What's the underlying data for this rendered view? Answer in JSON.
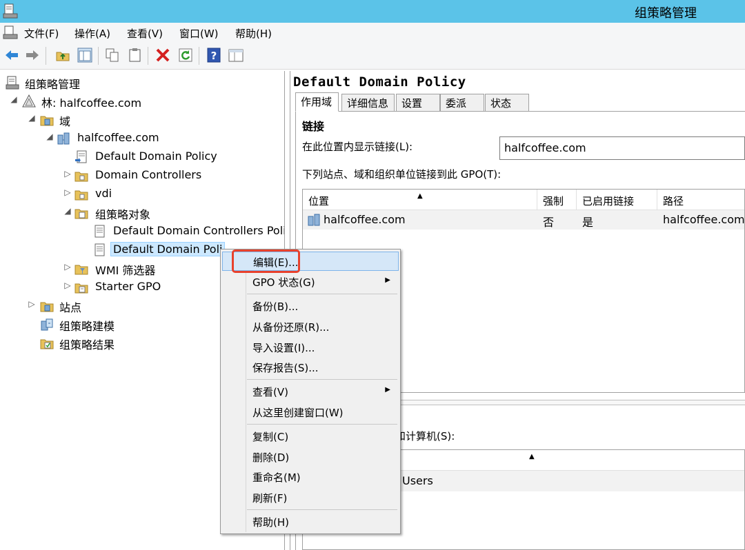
{
  "window": {
    "title": "组策略管理"
  },
  "menubar": {
    "items": [
      "文件(F)",
      "操作(A)",
      "查看(V)",
      "窗口(W)",
      "帮助(H)"
    ]
  },
  "toolbar": {
    "icons": [
      "back-arrow-icon",
      "forward-arrow-icon",
      "up-folder-icon",
      "show-hide-tree-icon",
      "copy-icon",
      "paste-icon",
      "delete-icon",
      "refresh-icon",
      "help-icon",
      "properties-icon"
    ]
  },
  "tree": {
    "root": "组策略管理",
    "forest": "林: halfcoffee.com",
    "domains": "域",
    "domain": "halfcoffee.com",
    "ddp_link": "Default Domain Policy",
    "dc_ou": "Domain Controllers",
    "vdi_ou": "vdi",
    "gpo_container": "组策略对象",
    "gpo_ddcp": "Default Domain Controllers Poli",
    "gpo_ddp": "Default Domain Poli",
    "wmi": "WMI 筛选器",
    "starter": "Starter GPO",
    "sites": "站点",
    "modeling": "组策略建模",
    "results": "组策略结果"
  },
  "right": {
    "heading": "Default Domain Policy",
    "tabs": [
      "作用域",
      "详细信息",
      "设置",
      "委派",
      "状态"
    ],
    "section_title": "链接",
    "show_links_label": "在此位置内显示链接(L):",
    "show_links_value": "halfcoffee.com",
    "linked_label": "下列站点、域和组织单位链接到此 GPO(T):",
    "columns": [
      "位置",
      "强制",
      "已启用链接",
      "路径"
    ],
    "rows": [
      {
        "location": "halfcoffee.com",
        "enforced": "否",
        "enabled": "是",
        "path": "halfcoffee.com"
      }
    ],
    "filter_label": "应用于下列组、用户和计算机(S):",
    "filter_row": "Users"
  },
  "context_menu": {
    "items": [
      {
        "label": "编辑(E)...",
        "submenu": false
      },
      {
        "label": "GPO 状态(G)",
        "submenu": true
      },
      {
        "label": "备份(B)...",
        "submenu": false
      },
      {
        "label": "从备份还原(R)...",
        "submenu": false
      },
      {
        "label": "导入设置(I)...",
        "submenu": false
      },
      {
        "label": "保存报告(S)...",
        "submenu": false
      },
      {
        "label": "查看(V)",
        "submenu": true
      },
      {
        "label": "从这里创建窗口(W)",
        "submenu": false
      },
      {
        "label": "复制(C)",
        "submenu": false
      },
      {
        "label": "删除(D)",
        "submenu": false
      },
      {
        "label": "重命名(M)",
        "submenu": false
      },
      {
        "label": "刷新(F)",
        "submenu": false
      },
      {
        "label": "帮助(H)",
        "submenu": false
      }
    ],
    "arrow_glyph": "▶"
  },
  "glyphs": {
    "expanded": "◢",
    "collapsed": "▷",
    "sort_up": "▲"
  },
  "colors": {
    "titlebar": "#5bc3e8",
    "highlight_border": "#e8412c",
    "selection": "#cce8ff"
  }
}
